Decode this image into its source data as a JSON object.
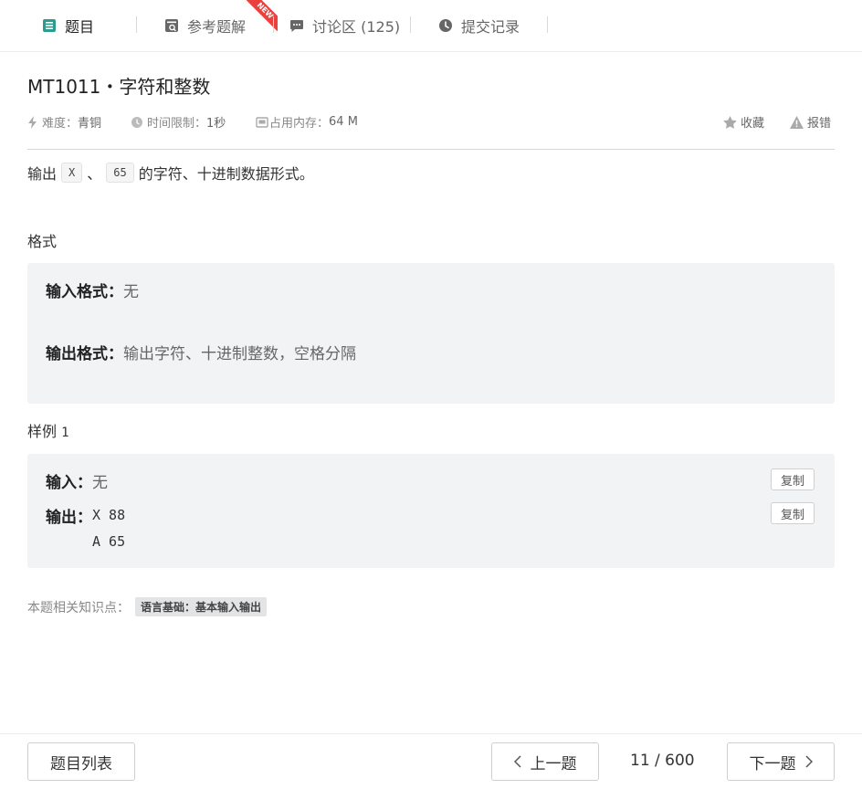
{
  "tabs": [
    {
      "label": "题目",
      "icon": "list-icon"
    },
    {
      "label": "参考题解",
      "icon": "solution-icon",
      "badge": "NEW"
    },
    {
      "label": "讨论区 (125)",
      "icon": "chat-icon"
    },
    {
      "label": "提交记录",
      "icon": "clock-icon"
    }
  ],
  "colors": {
    "accent": "#2a9d8f",
    "ribbon": "#e8413e",
    "box_bg": "#f2f3f5"
  },
  "problem": {
    "title": "MT1011・字符和整数",
    "difficulty_label": "难度：",
    "difficulty_value": "青铜",
    "time_label": "时间限制：",
    "time_value": "1秒",
    "memory_label": "占用内存：",
    "memory_value": "64 M",
    "favorite": "收藏",
    "report": "报错",
    "desc_prefix": "输出",
    "code1": "X",
    "desc_sep": "、",
    "code2": "65",
    "desc_suffix": "的字符、十进制数据形式。"
  },
  "format": {
    "heading": "格式",
    "input_label": "输入格式：",
    "input_value": "无",
    "output_label": "输出格式：",
    "output_value": "输出字符、十进制整数，空格分隔"
  },
  "sample": {
    "heading": "样例",
    "number": "1",
    "input_label": "输入：",
    "input_value": "无",
    "output_label": "输出：",
    "output_line1": "X 88",
    "output_line2": "A 65",
    "copy": "复制"
  },
  "knowledge": {
    "label": "本题相关知识点：",
    "tag": "语言基础：基本输入输出"
  },
  "footer": {
    "list_button": "题目列表",
    "prev_button": "上一题",
    "page": "11 / 600",
    "next_button": "下一题"
  }
}
